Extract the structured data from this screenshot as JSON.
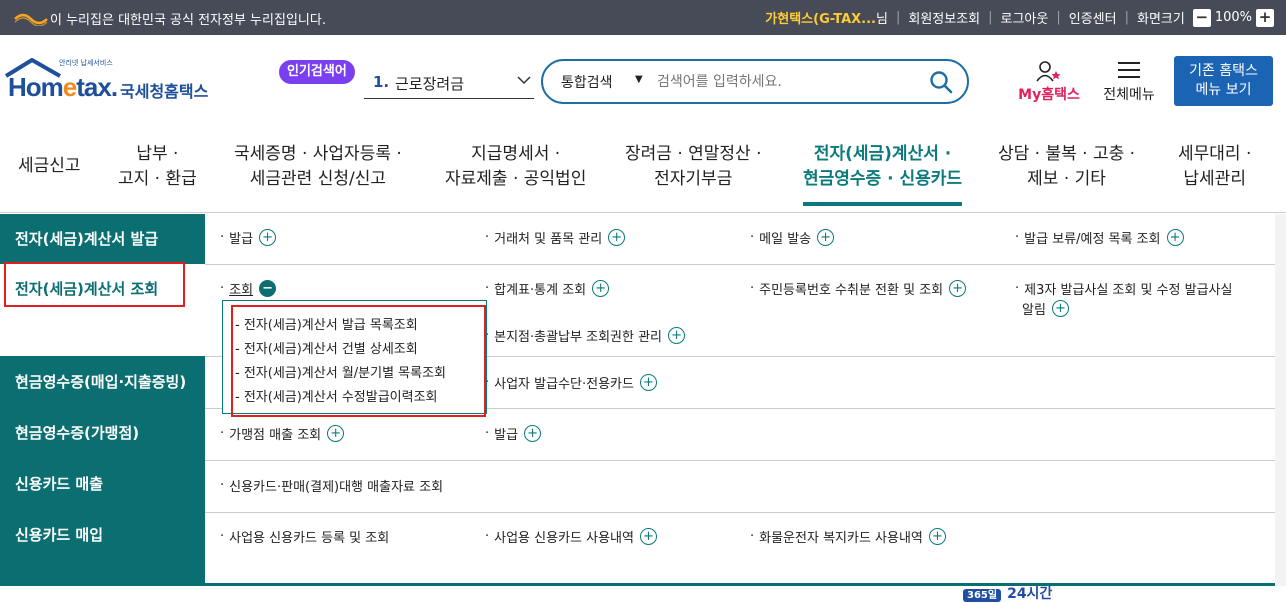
{
  "topbar": {
    "gov_notice": "이 누리집은 대한민국 공식 전자정부 누리집입니다.",
    "user_name": "가현택스(G-TAX...",
    "user_suffix": "님",
    "member_info": "회원정보조회",
    "logout": "로그아웃",
    "cert_center": "인증센터",
    "screen_size": "화면크기",
    "zoom_minus": "−",
    "zoom_level": "100%",
    "zoom_plus": "+"
  },
  "header": {
    "logo_sub": "안리넷 납세서비스",
    "logo_home_1": "Hom",
    "logo_home_e": "e",
    "logo_home_2": "tax.",
    "logo_name": "국세청홈택스",
    "popular_badge": "인기검색어",
    "popular_num": "1.",
    "popular_text": "근로장려금",
    "search_scope": "통합검색",
    "search_placeholder": "검색어를 입력하세요.",
    "my_label": "My홈택스",
    "all_menu": "전체메뉴",
    "legacy_line1": "기존 홈택스",
    "legacy_line2": "메뉴 보기"
  },
  "gnb": [
    {
      "l1": "세금신고",
      "l2": ""
    },
    {
      "l1": "납부 ·",
      "l2": "고지 · 환급"
    },
    {
      "l1": "국세증명 · 사업자등록 ·",
      "l2": "세금관련 신청/신고"
    },
    {
      "l1": "지급명세서 ·",
      "l2": "자료제출 · 공익법인"
    },
    {
      "l1": "장려금 · 연말정산 ·",
      "l2": "전자기부금"
    },
    {
      "l1": "전자(세금)계산서 ·",
      "l2": "현금영수증 · 신용카드"
    },
    {
      "l1": "상담 · 불복 · 고충 ·",
      "l2": "제보 · 기타"
    },
    {
      "l1": "세무대리 ·",
      "l2": "납세관리"
    }
  ],
  "categories": [
    "전자(세금)계산서 발급",
    "전자(세금)계산서 조회",
    "현금영수증(매입·지출증빙)",
    "현금영수증(가맹점)",
    "신용카드 매출",
    "신용카드 매입"
  ],
  "menu": {
    "issue": [
      "발급",
      "거래처 및 품목 관리",
      "메일 발송",
      "발급 보류/예정 목록 조회"
    ],
    "inquiry": [
      "조회",
      "합계표·통계 조회",
      "주민등록번호 수취분 전환 및 조회",
      "제3자 발급사실 조회 및 수정 발급사실",
      "알림",
      "본지점·총괄납부 조회권한 관리"
    ],
    "cash_buy": [
      "사업자 발급수단·전용카드"
    ],
    "cash_store": [
      "가맹점 매출 조회",
      "발급"
    ],
    "card_sales": [
      "신용카드·판매(결제)대행 매출자료 조회"
    ],
    "card_buy": [
      "사업용 신용카드 등록 및 조회",
      "사업용 신용카드 사용내역",
      "화물운전자 복지카드 사용내역"
    ]
  },
  "popup_items": [
    "전자(세금)계산서 발급 목록조회",
    "전자(세금)계산서 건별 상세조회",
    "전자(세금)계산서 월/분기별 목록조회",
    "전자(세금)계산서 수정발급이력조회"
  ],
  "peek": {
    "badge": "365일",
    "text": "24시간"
  },
  "colors": {
    "accent": "#0b6e70",
    "topbar": "#474a57",
    "brand_blue": "#1b64b3",
    "highlight": "#e02020"
  }
}
